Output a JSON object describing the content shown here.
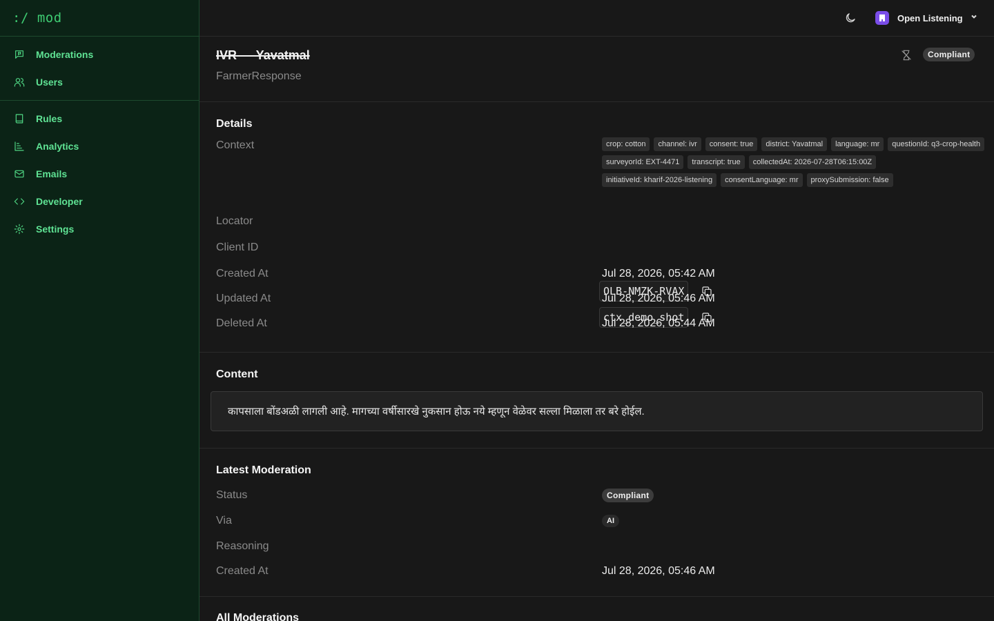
{
  "app": {
    "logo": ":/ mod"
  },
  "sidebar": {
    "groups": [
      {
        "items": [
          {
            "label": "Moderations",
            "icon": "message-square-flag-icon"
          },
          {
            "label": "Users",
            "icon": "users-icon"
          }
        ]
      },
      {
        "items": [
          {
            "label": "Rules",
            "icon": "book-icon"
          },
          {
            "label": "Analytics",
            "icon": "chart-icon"
          },
          {
            "label": "Emails",
            "icon": "mail-icon"
          },
          {
            "label": "Developer",
            "icon": "code-icon"
          },
          {
            "label": "Settings",
            "icon": "gear-icon"
          }
        ]
      }
    ]
  },
  "topbar": {
    "org_name": "Open Listening",
    "org_color": "#7a4de8"
  },
  "record": {
    "title": "IVR — Yavatmal",
    "type": "FarmerResponse",
    "status_badge": "Compliant"
  },
  "details": {
    "title": "Details",
    "context_label": "Context",
    "context_tags": [
      "crop: cotton",
      "channel: ivr",
      "consent: true",
      "district: Yavatmal",
      "language: mr",
      "questionId: q3-crop-health",
      "surveyorId: EXT-4471",
      "transcript: true",
      "collectedAt: 2026-07-28T06:15:00Z",
      "initiativeId: kharif-2026-listening",
      "consentLanguage: mr",
      "proxySubmission: false"
    ],
    "locator_label": "Locator",
    "locator": "OLB-NMZK-RVAX",
    "client_id_label": "Client ID",
    "client_id": "ctx_demo_shot",
    "created_label": "Created At",
    "created": "Jul 28, 2026, 05:42 AM",
    "updated_label": "Updated At",
    "updated": "Jul 28, 2026, 05:46 AM",
    "deleted_label": "Deleted At",
    "deleted": "Jul 28, 2026, 05:44 AM"
  },
  "content": {
    "title": "Content",
    "text": "कापसाला बोंडअळी लागली आहे. मागच्या वर्षीसारखे नुकसान होऊ नये म्हणून वेळेवर सल्ला मिळाला तर बरे होईल."
  },
  "latest": {
    "title": "Latest Moderation",
    "status_label": "Status",
    "status": "Compliant",
    "via_label": "Via",
    "via": "AI",
    "reasoning_label": "Reasoning",
    "created_label": "Created At",
    "created": "Jul 28, 2026, 05:46 AM"
  },
  "all": {
    "title": "All Moderations"
  }
}
